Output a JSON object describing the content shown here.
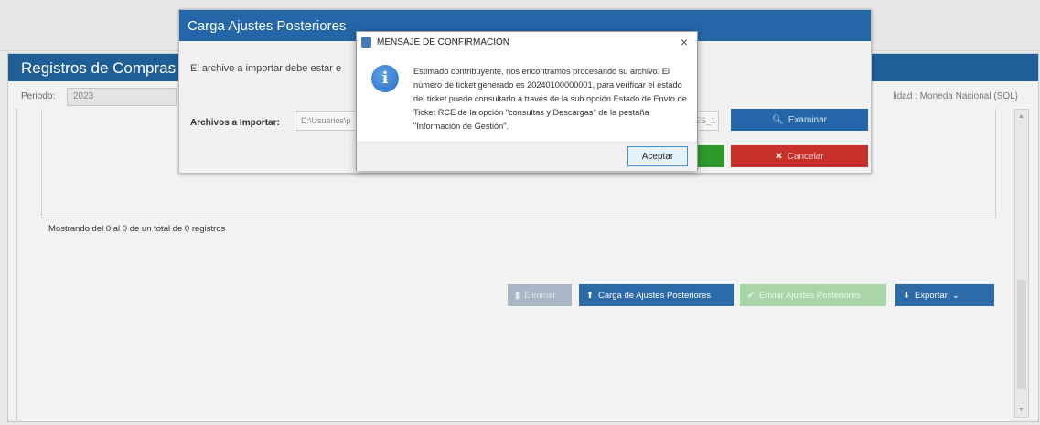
{
  "background": {
    "panel_title": "Registros de Compras",
    "periodo_label": "Periodo:",
    "periodo_value": "2023",
    "moneda_text": "lidad : Moneda Nacional (SOL)",
    "records_info": "Mostrando del 0 al 0 de un total de 0 registros",
    "buttons": {
      "eliminar": "Eliminar",
      "carga": "Carga de Ajustes Posteriores",
      "enviar": "Enviar Ajustes Posteriores",
      "exportar": "Exportar"
    }
  },
  "carga_modal": {
    "title": "Carga Ajustes Posteriores",
    "message": "El archivo a importar debe estar e",
    "archivos_label": "Archivos a Importar:",
    "file_path": "D:\\Usuarios\\p",
    "file_suffix": "ES_1",
    "examinar": "Examinar",
    "cancelar": "Cancelar"
  },
  "confirm_dialog": {
    "title": "MENSAJE DE CONFIRMACIÓN",
    "close": "×",
    "message": "Estimado contribuyente, nos encontramos procesando su archivo. El número de ticket generado es 20240100000001, para verificar el estado del ticket puede consultarlo a través de la sub opción Estado de Envío de Ticket RCE de la opción \"consultas y Descargas\" de la pestaña \"Información de Gestión\".",
    "accept": "Aceptar"
  },
  "icons": {
    "info": "info-icon",
    "search": "search-icon",
    "close": "close-icon",
    "upload": "upload-icon",
    "download": "download-icon",
    "check": "check-icon",
    "trash": "trash-icon"
  },
  "colors": {
    "header_blue": "#2466a8",
    "danger_red": "#c8302c",
    "success_green": "#2d9a2d"
  }
}
